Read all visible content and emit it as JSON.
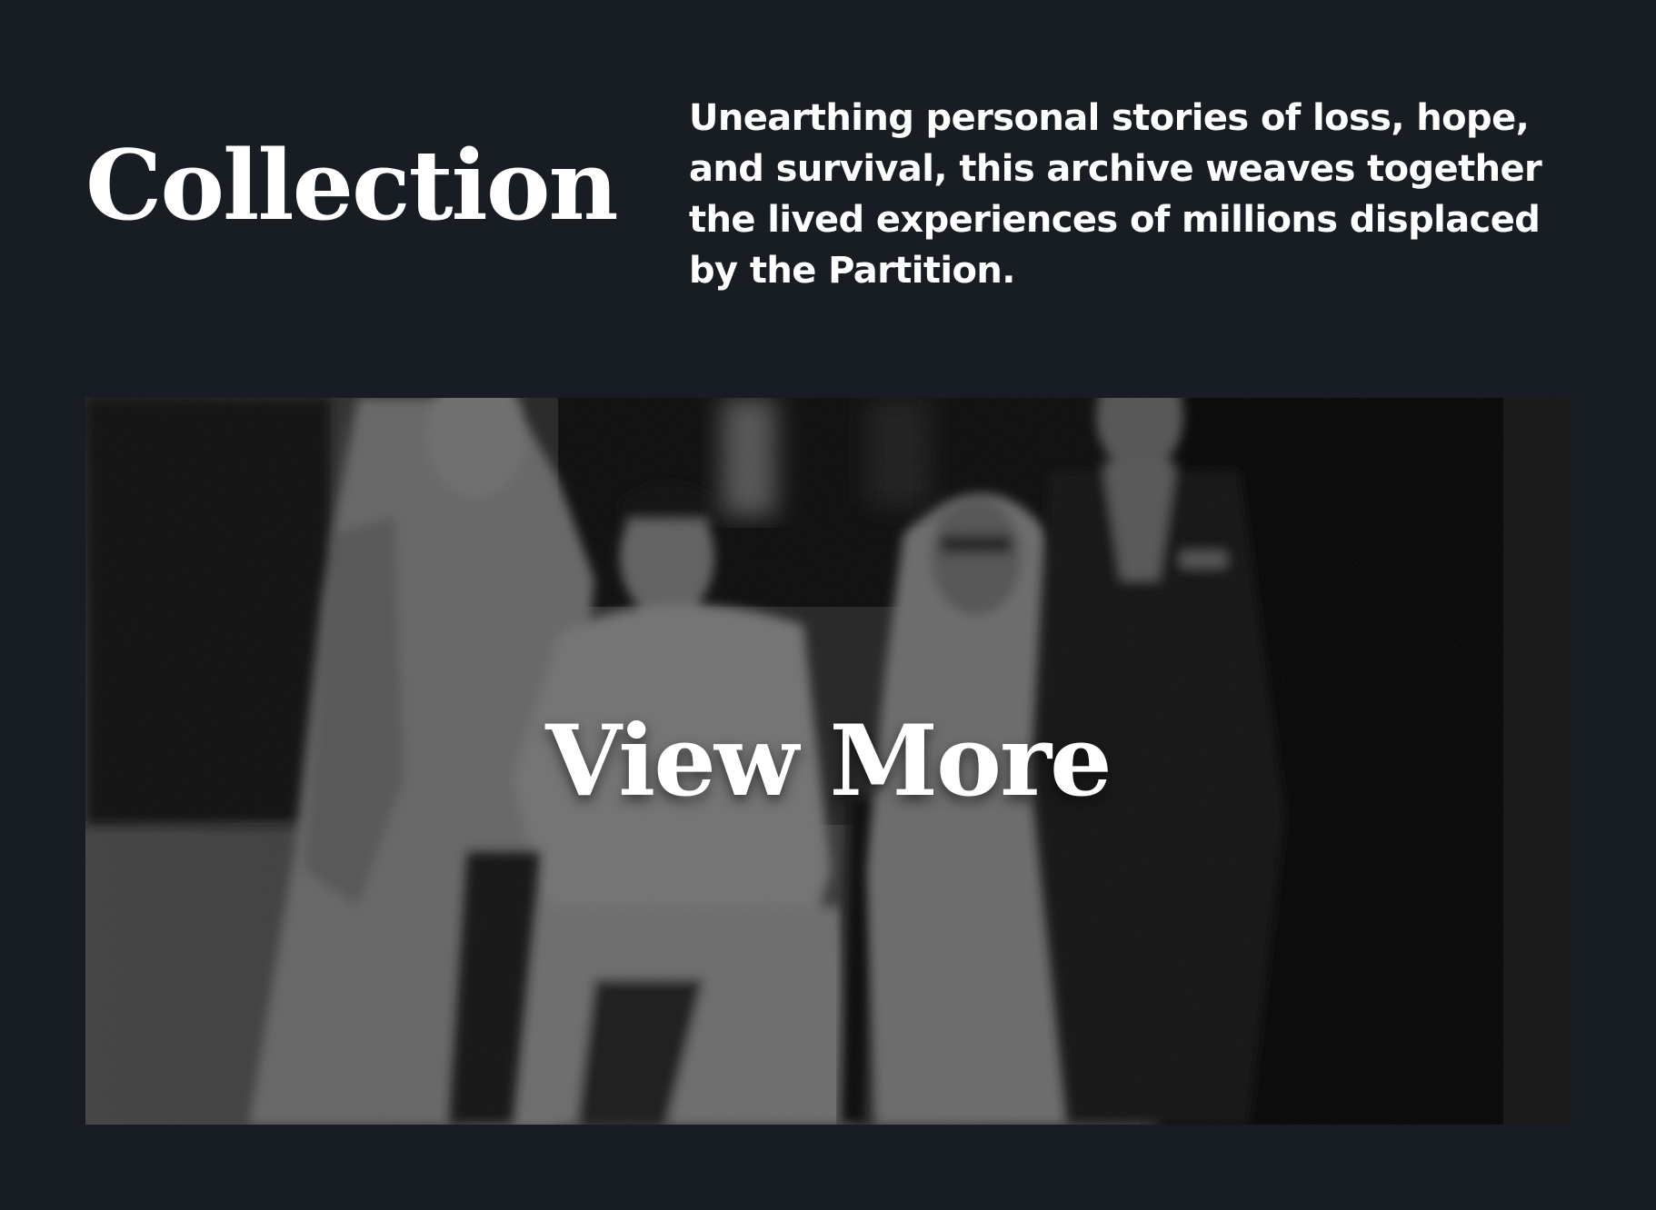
{
  "section": {
    "title": "Collection",
    "description": "Unearthing personal stories of loss, hope, and survival, this archive weaves together the lived experiences of millions displaced by the Partition."
  },
  "feature": {
    "cta_label": "View More",
    "image_kind": "black-and-white archival family photograph",
    "overlay_color": "#000000"
  },
  "theme": {
    "background": "#181d24",
    "text": "#ffffff"
  }
}
